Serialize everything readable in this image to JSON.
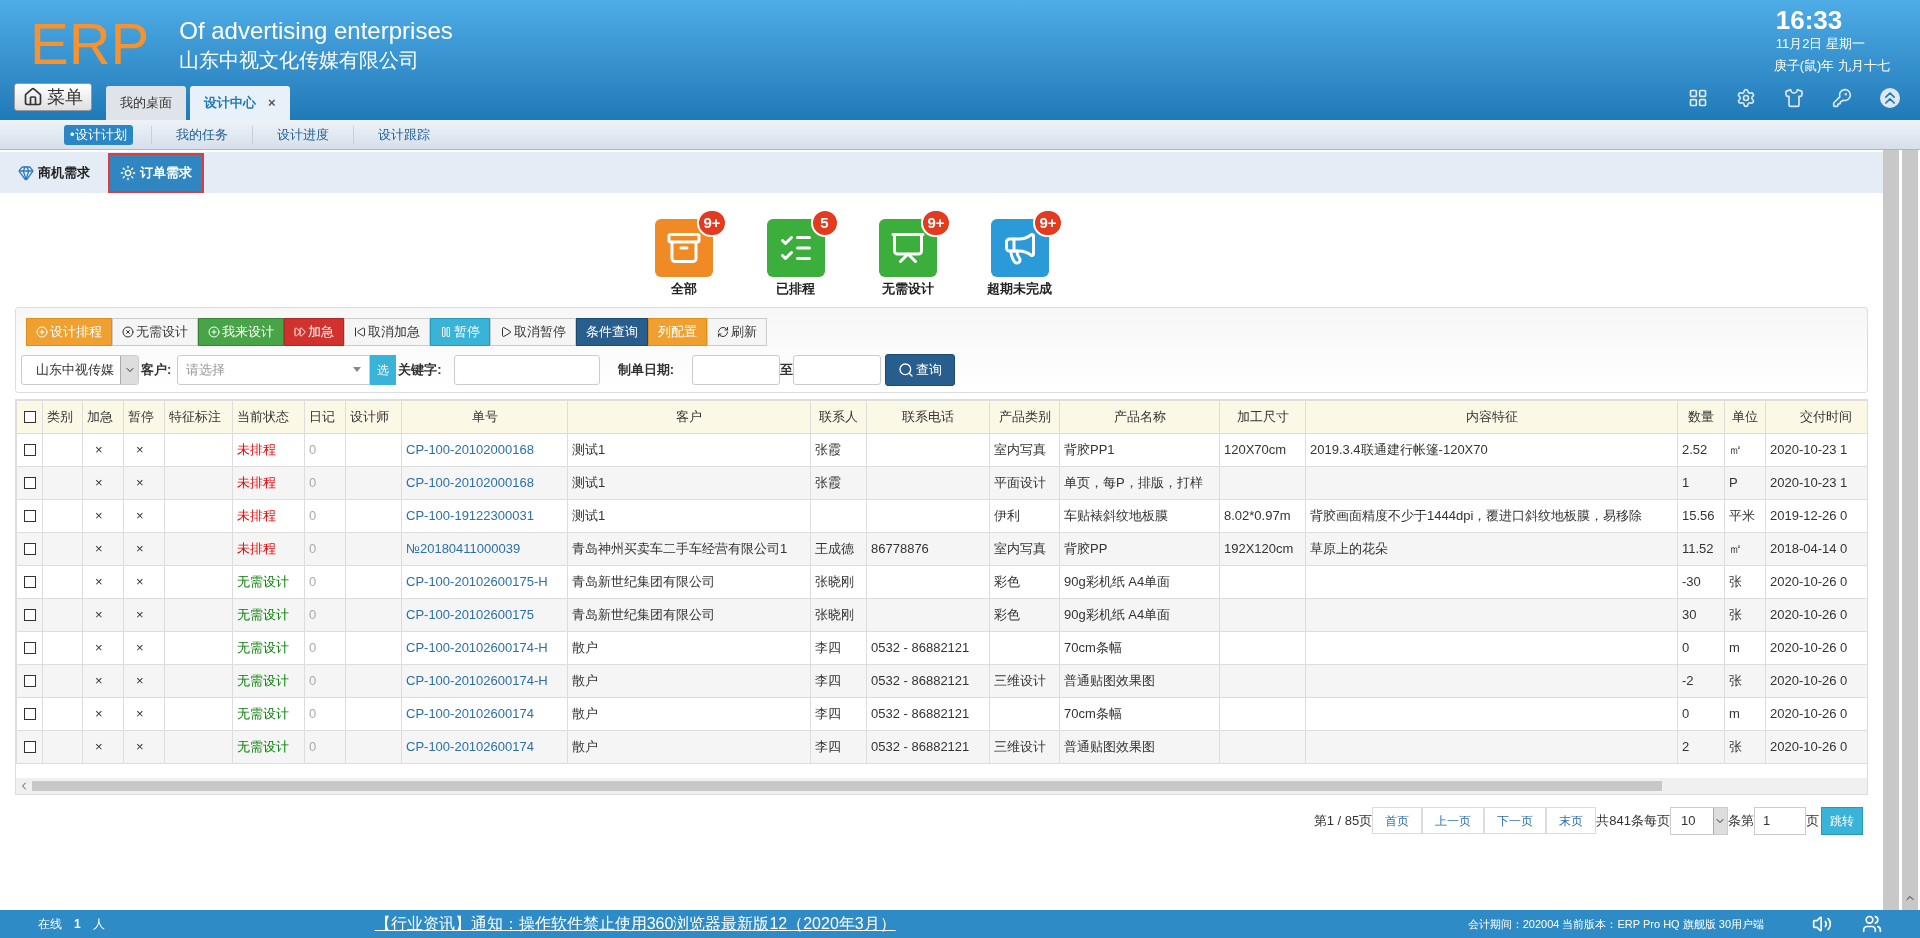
{
  "header": {
    "logo": "ERP",
    "title": "Of advertising enterprises",
    "company": "山东中视文化传媒有限公司",
    "time": "16:33",
    "date": "11月2日 星期一",
    "lunar": "庚子(鼠)年 九月十七"
  },
  "menu_button": "菜单",
  "tabs": [
    {
      "label": "我的桌面",
      "selected": false
    },
    {
      "label": "设计中心",
      "selected": true,
      "close": "×"
    }
  ],
  "subnav": [
    {
      "label": "•设计计划",
      "selected": true
    },
    {
      "label": "我的任务",
      "selected": false
    },
    {
      "label": "设计进度",
      "selected": false
    },
    {
      "label": "设计跟踪",
      "selected": false
    }
  ],
  "subtabs": [
    {
      "label": "商机需求",
      "selected": false,
      "kind": "gem"
    },
    {
      "label": "订单需求",
      "selected": true,
      "kind": "sun"
    }
  ],
  "categories": [
    {
      "label": "全部",
      "badge": "9+",
      "kind": "drawer",
      "color": "#f08a24"
    },
    {
      "label": "已排程",
      "badge": "5",
      "kind": "list",
      "color": "#3cae3c"
    },
    {
      "label": "无需设计",
      "badge": "9+",
      "kind": "board",
      "color": "#3cae3c"
    },
    {
      "label": "超期未完成",
      "badge": "9+",
      "kind": "horn",
      "color": "#2a9ad8"
    }
  ],
  "toolbar": [
    {
      "label": "设计排程",
      "kind": "warning"
    },
    {
      "label": "无需设计",
      "kind": "default"
    },
    {
      "label": "我来设计",
      "kind": "success"
    },
    {
      "label": "加急",
      "kind": "danger"
    },
    {
      "label": "取消加急",
      "kind": "default"
    },
    {
      "label": "暂停",
      "kind": "info"
    },
    {
      "label": "取消暂停",
      "kind": "default"
    },
    {
      "label": "条件查询",
      "kind": "primary"
    },
    {
      "label": "列配置",
      "kind": "warning"
    },
    {
      "label": "刷新",
      "kind": "default"
    }
  ],
  "filters": {
    "company": "山东中视传媒",
    "customer_label": "客户:",
    "customer_placeholder": "请选择",
    "pick_button": "选",
    "keyword_label": "关键字:",
    "date_label": "制单日期:",
    "to_label": "至",
    "query_button": "查询"
  },
  "table": {
    "header_checked": false,
    "columns": [
      "类别",
      "加急",
      "暂停",
      "特征标注",
      "当前状态",
      "日记",
      "设计师",
      "单号",
      "客户",
      "联系人",
      "联系电话",
      "产品类别",
      "产品名称",
      "加工尺寸",
      "内容特征",
      "数量",
      "单位",
      "交付时间"
    ],
    "rows": [
      {
        "checked": false,
        "urgent": "×",
        "paused": "×",
        "status": "未排程",
        "kind": "unscheduled",
        "diary": "0",
        "order_no": "CP-100-20102000168",
        "customer": "测试1",
        "contact": "张霞",
        "phone": "",
        "product_type": "室内写真",
        "product": "背胶PP1",
        "size": "120X70cm",
        "content": "2019.3.4联通建行帐篷-120X70",
        "qty": "2.52",
        "unit": "㎡",
        "delivery": "2020-10-23 1"
      },
      {
        "checked": false,
        "urgent": "×",
        "paused": "×",
        "status": "未排程",
        "kind": "unscheduled",
        "diary": "0",
        "order_no": "CP-100-20102000168",
        "customer": "测试1",
        "contact": "张霞",
        "phone": "",
        "product_type": "平面设计",
        "product": "单页，每P，排版，打样",
        "size": "",
        "content": "",
        "qty": "1",
        "unit": "P",
        "delivery": "2020-10-23 1"
      },
      {
        "checked": false,
        "urgent": "×",
        "paused": "×",
        "status": "未排程",
        "kind": "unscheduled",
        "diary": "0",
        "order_no": "CP-100-19122300031",
        "customer": "测试1",
        "contact": "",
        "phone": "",
        "product_type": "伊利",
        "product": "车贴裱斜纹地板膜",
        "size": "8.02*0.97m",
        "content": "背胶画面精度不少于1444dpi，覆进口斜纹地板膜，易移除",
        "qty": "15.56",
        "unit": "平米",
        "delivery": "2019-12-26 0"
      },
      {
        "checked": false,
        "urgent": "×",
        "paused": "×",
        "status": "未排程",
        "kind": "unscheduled",
        "diary": "0",
        "order_no": "№20180411000039",
        "customer": "青岛神州买卖车二手车经营有限公司1",
        "contact": "王成德",
        "phone": "86778876",
        "product_type": "室内写真",
        "product": "背胶PP",
        "size": "192X120cm",
        "content": "草原上的花朵",
        "qty": "11.52",
        "unit": "㎡",
        "delivery": "2018-04-14 0"
      },
      {
        "checked": false,
        "urgent": "×",
        "paused": "×",
        "status": "无需设计",
        "kind": "no_design",
        "diary": "0",
        "order_no": "CP-100-20102600175-H",
        "customer": "青岛新世纪集团有限公司",
        "contact": "张晓刚",
        "phone": "",
        "product_type": "彩色",
        "product": "90g彩机纸 A4单面",
        "size": "",
        "content": "",
        "qty": "-30",
        "unit": "张",
        "delivery": "2020-10-26 0"
      },
      {
        "checked": false,
        "urgent": "×",
        "paused": "×",
        "status": "无需设计",
        "kind": "no_design",
        "diary": "0",
        "order_no": "CP-100-20102600175",
        "customer": "青岛新世纪集团有限公司",
        "contact": "张晓刚",
        "phone": "",
        "product_type": "彩色",
        "product": "90g彩机纸 A4单面",
        "size": "",
        "content": "",
        "qty": "30",
        "unit": "张",
        "delivery": "2020-10-26 0"
      },
      {
        "checked": false,
        "urgent": "×",
        "paused": "×",
        "status": "无需设计",
        "kind": "no_design",
        "diary": "0",
        "order_no": "CP-100-20102600174-H",
        "customer": "散户",
        "contact": "李四",
        "phone": "0532 - 86882121",
        "product_type": "",
        "product": "70cm条幅",
        "size": "",
        "content": "",
        "qty": "0",
        "unit": "m",
        "delivery": "2020-10-26 0"
      },
      {
        "checked": false,
        "urgent": "×",
        "paused": "×",
        "status": "无需设计",
        "kind": "no_design",
        "diary": "0",
        "order_no": "CP-100-20102600174-H",
        "customer": "散户",
        "contact": "李四",
        "phone": "0532 - 86882121",
        "product_type": "三维设计",
        "product": "普通贴图效果图",
        "size": "",
        "content": "",
        "qty": "-2",
        "unit": "张",
        "delivery": "2020-10-26 0"
      },
      {
        "checked": false,
        "urgent": "×",
        "paused": "×",
        "status": "无需设计",
        "kind": "no_design",
        "diary": "0",
        "order_no": "CP-100-20102600174",
        "customer": "散户",
        "contact": "李四",
        "phone": "0532 - 86882121",
        "product_type": "",
        "product": "70cm条幅",
        "size": "",
        "content": "",
        "qty": "0",
        "unit": "m",
        "delivery": "2020-10-26 0"
      },
      {
        "checked": false,
        "urgent": "×",
        "paused": "×",
        "status": "无需设计",
        "kind": "no_design",
        "diary": "0",
        "order_no": "CP-100-20102600174",
        "customer": "散户",
        "contact": "李四",
        "phone": "0532 - 86882121",
        "product_type": "三维设计",
        "product": "普通贴图效果图",
        "size": "",
        "content": "",
        "qty": "2",
        "unit": "张",
        "delivery": "2020-10-26 0"
      }
    ]
  },
  "pagination": {
    "page_info": "第1 / 85页",
    "buttons": [
      "首页",
      "上一页",
      "下一页",
      "末页"
    ],
    "total": "共841条每页",
    "page_size": "10",
    "goto_label": "条第",
    "page_input": "1",
    "page_suffix": "页",
    "jump_button": "跳转"
  },
  "status_bar": {
    "online_label": "在线",
    "online_count": "1",
    "online_unit": "人",
    "notice": "【行业资讯】通知：操作软件禁止使用360浏览器最新版12（2020年3月）",
    "version": "会计期间：202004 当前版本：ERP Pro HQ 旗舰版 30用户端"
  }
}
